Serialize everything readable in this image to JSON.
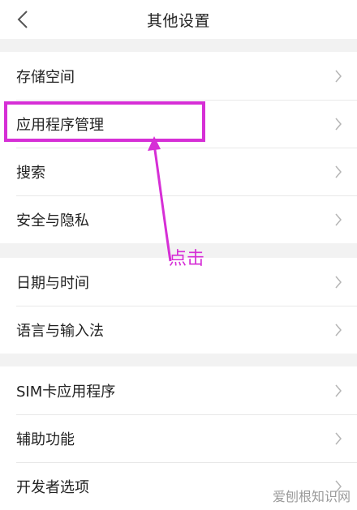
{
  "header": {
    "title": "其他设置"
  },
  "groups": [
    {
      "items": [
        {
          "label": "存储空间"
        },
        {
          "label": "应用程序管理"
        },
        {
          "label": "搜索"
        },
        {
          "label": "安全与隐私"
        }
      ]
    },
    {
      "items": [
        {
          "label": "日期与时间"
        },
        {
          "label": "语言与输入法"
        }
      ]
    },
    {
      "items": [
        {
          "label": "SIM卡应用程序"
        },
        {
          "label": "辅助功能"
        },
        {
          "label": "开发者选项"
        }
      ]
    }
  ],
  "annotation": {
    "text": "点击",
    "color": "#d62fd6"
  },
  "watermark": "爱刨根知识网"
}
